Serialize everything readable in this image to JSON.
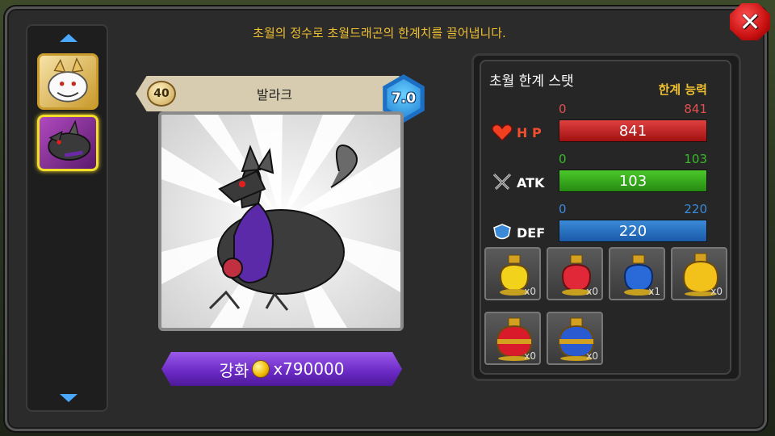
{
  "header": {
    "message": "초월의 정수로 초월드래곤의 한계치를 끌어냅니다.",
    "close_icon": "close-icon"
  },
  "dragon_list": {
    "items": [
      {
        "name": "white-dragon-thumb",
        "selected": false
      },
      {
        "name": "dark-dragon-thumb",
        "selected": true
      }
    ]
  },
  "dragon": {
    "level": "40",
    "name": "발라크",
    "grade": "7.0"
  },
  "upgrade": {
    "label": "강화",
    "cost": "x790000",
    "icon": "gold-coin-icon"
  },
  "stats": {
    "title": "초월 한계 스탯",
    "limit_label": "한계 능력",
    "rows": [
      {
        "label": "H P",
        "min": "0",
        "max": "841",
        "value": "841",
        "color": "#c82020",
        "icon": "heart-icon"
      },
      {
        "label": "ATK",
        "min": "0",
        "max": "103",
        "value": "103",
        "color": "#3aa81e",
        "icon": "swords-icon"
      },
      {
        "label": "DEF",
        "min": "0",
        "max": "220",
        "value": "220",
        "color": "#2a70c0",
        "icon": "shield-icon"
      }
    ]
  },
  "potions": [
    {
      "color": "yellow",
      "count": "x0"
    },
    {
      "color": "red",
      "count": "x0"
    },
    {
      "color": "blue",
      "count": "x1"
    },
    {
      "color": "gold",
      "count": "x0"
    },
    {
      "color": "red-large",
      "count": "x0"
    },
    {
      "color": "blue-large",
      "count": "x0"
    }
  ]
}
